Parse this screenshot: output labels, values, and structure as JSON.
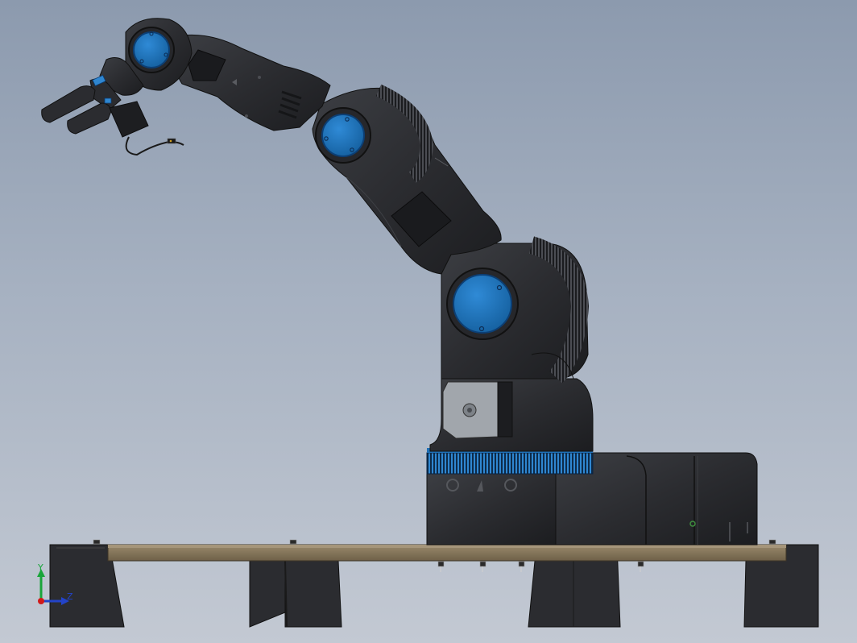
{
  "viewport": {
    "background_top": "#8c9aae",
    "background_bottom": "#c3c9d3"
  },
  "model": {
    "body_color": "#2b2c30",
    "body_shade": "#1c1d20",
    "body_highlight": "#3c3e43",
    "joint_cap_color": "#1f78c6",
    "joint_cap_rim": "#0c3f75",
    "accent_ring_color": "#2f86d0",
    "motor_plate_color": "#9ea3a9",
    "table_board_color": "#8a7a5e",
    "table_board_shade": "#6e6048",
    "cable_color": "#1a1a1a"
  },
  "triad": {
    "y_label": "Y",
    "z_label": "Z",
    "y_color": "#19a53a",
    "z_color": "#2343c8",
    "origin_color": "#d11a1a"
  }
}
